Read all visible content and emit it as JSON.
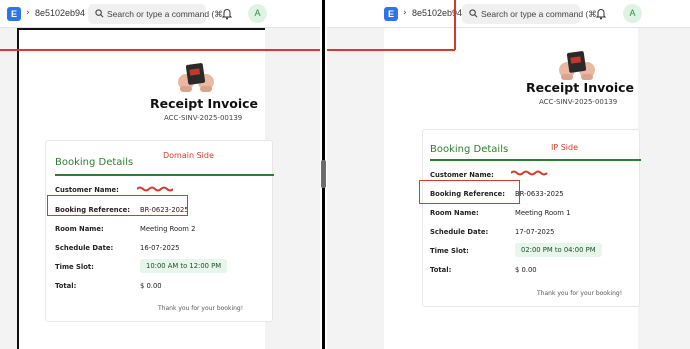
{
  "app": {
    "logo_letter": "E",
    "breadcrumb": "8e5102eb94"
  },
  "search": {
    "placeholder": "Search or type a command (⌘"
  },
  "user": {
    "avatar_letter": "A"
  },
  "invoice": {
    "title": "Receipt Invoice",
    "number": "ACC-SINV-2025-00139"
  },
  "labels": {
    "section": "Booking Details",
    "customer": "Customer Name:",
    "reference": "Booking Reference:",
    "room": "Room Name:",
    "date": "Schedule Date:",
    "slot": "Time Slot:",
    "total": "Total:",
    "thanks": "Thank you for your booking!"
  },
  "left": {
    "breadcrumb": "8e5102eb94",
    "search_placeholder": "Search or type a command (⌘",
    "note": "Domain Side",
    "reference": "BR-0623-2025",
    "room": "Meeting Room 2",
    "date": "16-07-2025",
    "slot": "10:00 AM to 12:00 PM",
    "total": "$ 0.00"
  },
  "right": {
    "breadcrumb": "8e5102eb94",
    "search_placeholder": "Search or type a command (⌘",
    "note": "IP Side",
    "reference": "BR-0633-2025",
    "room": "Meeting Room 1",
    "date": "17-07-2025",
    "slot": "02:00 PM to 04:00 PM",
    "total": "$ 0.00"
  },
  "colors": {
    "accent_green": "#2e7d32",
    "annotation_red": "#d23b2a",
    "logo_blue": "#2f73e8"
  },
  "icons": [
    "search-icon",
    "bell-icon",
    "chevron-right-icon"
  ]
}
